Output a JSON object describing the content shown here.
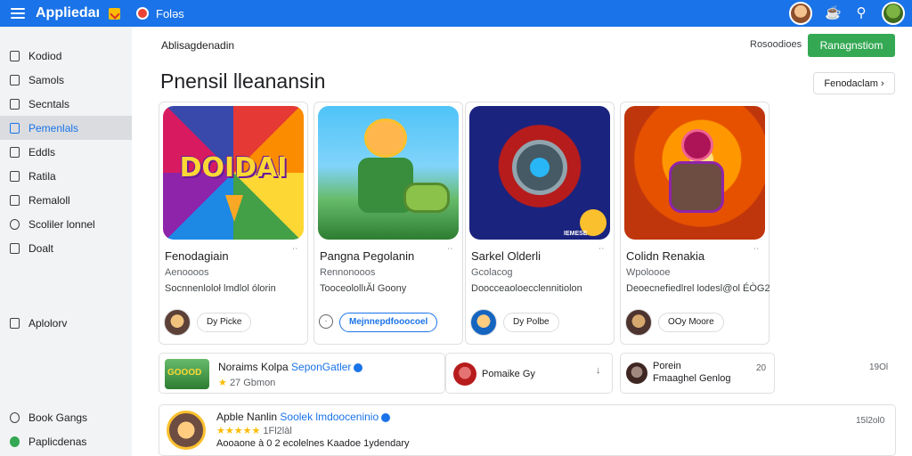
{
  "topbar": {
    "app_title": "Appliedaı",
    "link": "Foləs"
  },
  "sidebar": {
    "items": [
      {
        "label": "Kodiod"
      },
      {
        "label": "Samols"
      },
      {
        "label": "Secntals"
      },
      {
        "label": "Pemenlals"
      },
      {
        "label": "Eddls"
      },
      {
        "label": "Ratila"
      },
      {
        "label": "Remaloll"
      },
      {
        "label": "Scoliler lonnel"
      },
      {
        "label": "Doalt"
      }
    ],
    "middle_item": {
      "label": "Aplolorv"
    },
    "bottom_items": [
      {
        "label": "Book Gangs"
      },
      {
        "label": "Paplicdenas"
      }
    ]
  },
  "header": {
    "breadcrumb": "Ablisagdenadin",
    "secondary_link": "Rosoodioes",
    "primary_button": "Ranagnstiom",
    "page_title": "Pnensil lleanansin",
    "see_all_button": "Fenodaclam ›"
  },
  "cards": [
    {
      "logo_text": "DOIDAI",
      "title": "Fenodagiain",
      "subtitle": "Aenoooos",
      "desc": "Socnnenloloł lmdlol ólorin",
      "pill": "Dy Picke",
      "dots": "˙˙"
    },
    {
      "title": "Pangna Pegolanin",
      "subtitle": "Rennonooos",
      "desc": "TooceolollıĂl Goony",
      "pill": "Mejnnepdfooocoel",
      "dots": "˙˙",
      "plus": "·"
    },
    {
      "badge_text": "IEMESE",
      "title": "Sarkel Olderli",
      "subtitle": "Gcolacog",
      "desc": "Doocceaoloecclennitiolon",
      "pill": "Dy Polbe",
      "dots": "˙˙"
    },
    {
      "title": "Colidn Renakia",
      "subtitle": "Wpoloooe",
      "desc": "Deoecnefiedlrel lodesl@ol ÉÒG2",
      "pill": "OOy Moore",
      "dots": "˙˙"
    }
  ],
  "list_row_1": {
    "thumb_text": "GOOOD",
    "title": "Noraims Kolpa",
    "title_blue": "SeponGatler",
    "rating": "★",
    "meta": "27 Gbmon",
    "middle_text": "Pomaike Gy",
    "middle_icon": "↓",
    "right_title": "Porein",
    "right_sub": "Fmaaghel Genlog",
    "right_num": "20",
    "far_num": "19Ol"
  },
  "list_row_2": {
    "title": "Apble Nanlin",
    "title_blue": "Soolek lmdooceninio",
    "stars": "★★★★★",
    "star_meta": "1Fl2làl",
    "meta": "Aooaone à 0 2  ecolelnes  Kaadoe  1ydendary",
    "num": "15l2ol0"
  },
  "colors": {
    "topbar": "#1a73e8",
    "primary_button": "#34a853",
    "accent_blue": "#1a73e8",
    "star": "#fbbc04"
  }
}
